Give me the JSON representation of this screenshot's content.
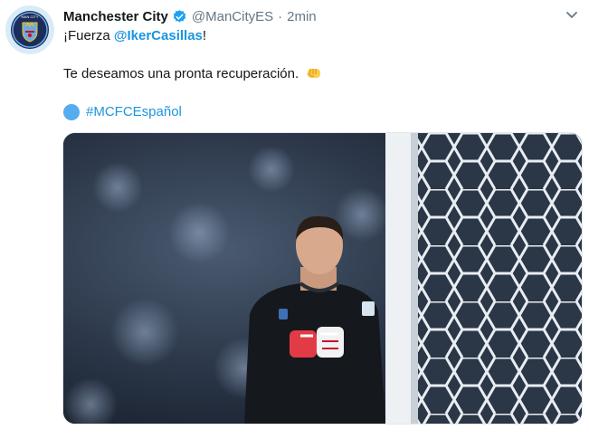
{
  "tweet": {
    "account_name": "Manchester City",
    "handle": "@ManCityES",
    "separator": "·",
    "timestamp": "2min",
    "line1_prefix": "¡Fuerza ",
    "mention": "@IkerCasillas",
    "line1_suffix": "!",
    "line2_text": "Te deseamos una pronta recuperación.",
    "hashtag": "#MCFCEspañol"
  },
  "icons": {
    "verified": "verified-badge-icon",
    "caret": "chevron-down-icon",
    "fist": "oncoming-fist-emoji",
    "circle": "blue-circle-emoji"
  },
  "colors": {
    "link": "#1b95e0",
    "muted": "#657786",
    "verified": "#1da1f2",
    "club_sky_blue": "#6cabdd"
  }
}
